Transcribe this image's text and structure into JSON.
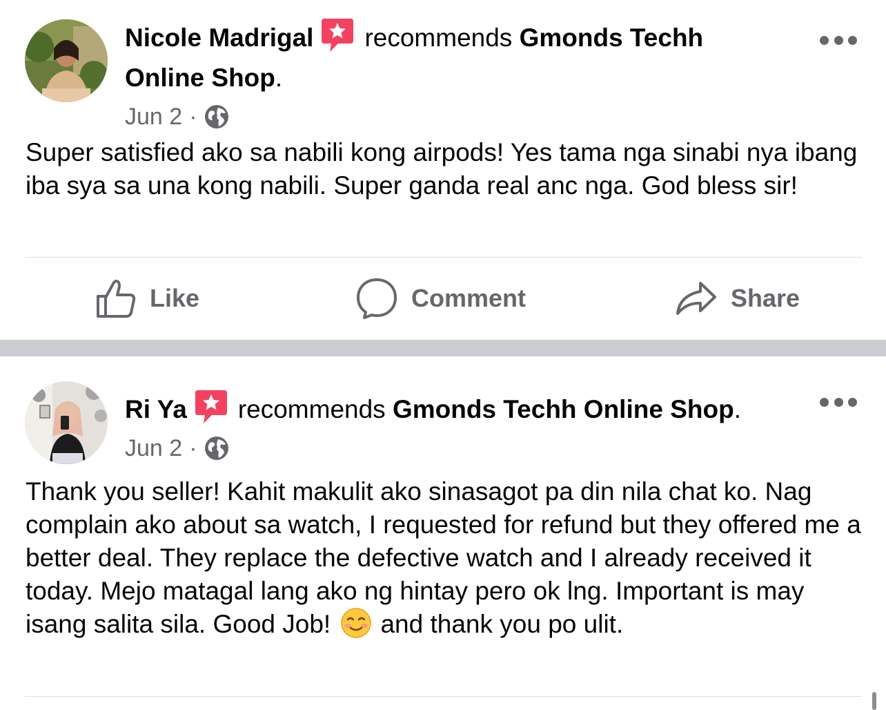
{
  "posts": [
    {
      "author": "Nicole Madrigal",
      "action_text": "recommends",
      "page_name_line1": "Gmonds Techh",
      "page_name_line2": "Online Shop",
      "page_suffix": ".",
      "date": "Jun 2",
      "separator": "·",
      "body": "Super satisfied ako sa nabili kong airpods! Yes tama nga sinabi nya ibang iba sya sa una kong nabili. Super ganda real anc nga. God bless sir!",
      "actions": {
        "like": "Like",
        "comment": "Comment",
        "share": "Share"
      }
    },
    {
      "author": "Ri Ya",
      "action_text": "recommends",
      "page_name": "Gmonds Techh Online Shop",
      "page_suffix": ".",
      "date": "Jun 2",
      "separator": "·",
      "body_before_emoji": "Thank you seller! Kahit makulit ako sinasagot pa din nila chat ko. Nag complain ako about sa watch, I requested for refund but they offered me a better deal. They replace the defective watch and I already received it today. Mejo matagal lang ako ng hintay pero ok lng. Important is may isang salita sila. Good Job!",
      "emoji": "smiling-face-emoji",
      "body_after_emoji": "and thank you po ulit."
    }
  ],
  "colors": {
    "text_primary": "#050505",
    "text_secondary": "#65676b",
    "separator": "#c9ccd1",
    "divider": "#dadde1",
    "recommend_badge": "#f3425f"
  },
  "icons": [
    "recommend-badge-icon",
    "globe-icon",
    "more-options-icon",
    "like-icon",
    "comment-icon",
    "share-icon"
  ]
}
